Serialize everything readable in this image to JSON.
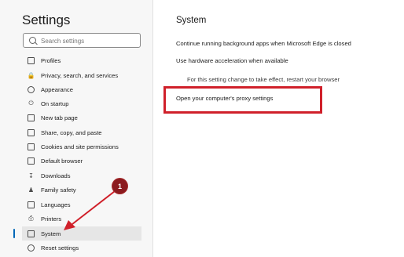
{
  "sidebar": {
    "title": "Settings",
    "search_placeholder": "Search settings",
    "items": [
      {
        "label": "Profiles",
        "icon": "profile-icon"
      },
      {
        "label": "Privacy, search, and services",
        "icon": "lock-icon"
      },
      {
        "label": "Appearance",
        "icon": "palette-icon"
      },
      {
        "label": "On startup",
        "icon": "power-icon"
      },
      {
        "label": "New tab page",
        "icon": "new-tab-icon"
      },
      {
        "label": "Share, copy, and paste",
        "icon": "share-icon"
      },
      {
        "label": "Cookies and site permissions",
        "icon": "cookies-icon"
      },
      {
        "label": "Default browser",
        "icon": "browser-icon"
      },
      {
        "label": "Downloads",
        "icon": "download-icon"
      },
      {
        "label": "Family safety",
        "icon": "family-icon"
      },
      {
        "label": "Languages",
        "icon": "languages-icon"
      },
      {
        "label": "Printers",
        "icon": "printer-icon"
      },
      {
        "label": "System",
        "icon": "laptop-icon",
        "active": true
      },
      {
        "label": "Reset settings",
        "icon": "reset-icon"
      }
    ]
  },
  "main": {
    "title": "System",
    "settings": [
      "Continue running background apps when Microsoft Edge is closed",
      "Use hardware acceleration when available",
      "For this setting change to take effect, restart your browser"
    ],
    "proxy_link": "Open your computer's proxy settings"
  },
  "annotation": {
    "step_number": "1",
    "highlight_color": "#d0202a",
    "marker_color": "#8b1a1e"
  }
}
